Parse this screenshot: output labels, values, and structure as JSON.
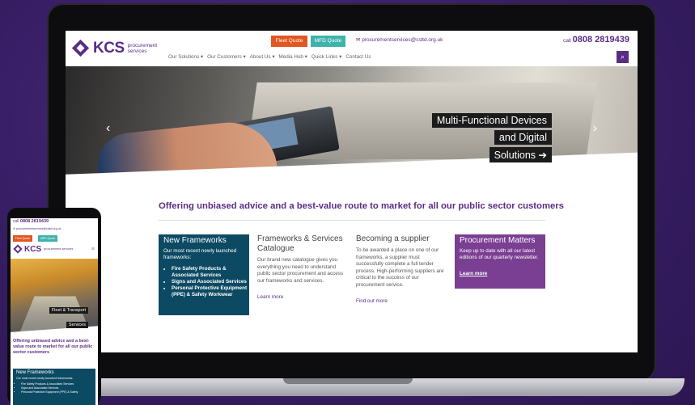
{
  "header": {
    "logo_text": "KCS",
    "logo_sub": "procurement services",
    "fleet_quote": "Fleet Quote",
    "mfd_quote": "MFD Quote",
    "email": "procurementservices@csltd.org.uk",
    "call_label": "call",
    "phone": "0808 2819439"
  },
  "nav": [
    "Our Solutions ▾",
    "Our Customers ▾",
    "About Us ▾",
    "Media Hub ▾",
    "Quick Links ▾",
    "Contact Us"
  ],
  "hero": {
    "caption": [
      "Multi-Functional Devices",
      "and Digital",
      "Solutions ➔"
    ],
    "prev": "‹",
    "next": "›"
  },
  "tagline": "Offering unbiased advice and a best-value route to market for all our public sector customers",
  "columns": {
    "new_frameworks": {
      "title": "New Frameworks",
      "intro": "Our most recent newly launched frameworks:",
      "items": [
        "Fire Safety Products & Associated Services",
        "Signs and Associated Services",
        "Personal Protective Equipment (PPE) & Safety Workwear"
      ]
    },
    "catalogue": {
      "title": "Frameworks & Services Catalogue",
      "body": "Our brand new catalogue gives you everything you need to understand public sector procurement and access our frameworks and services.",
      "link": "Learn more"
    },
    "supplier": {
      "title": "Becoming a supplier",
      "body": "To be awarded a place on one of our frameworks, a supplier must successfully complete a full tender process. High-performing suppliers are critical to the success of our procurement service.",
      "link": "Find out more"
    },
    "matters": {
      "title": "Procurement Matters",
      "body": "Keep up to date with all our latest editions of our quarterly newsletter.",
      "link": "Learn more"
    }
  },
  "mobile": {
    "call_label": "call",
    "phone": "0808 2819439",
    "email": "procurementservices@csltd.org.uk",
    "fleet_quote": "Fleet Quote",
    "mfd_quote": "MFD Quote",
    "logo_text": "KCS",
    "logo_sub": "procurement services",
    "menu_icon": "≡",
    "caption": [
      "Fleet & Transport",
      "Services"
    ],
    "tagline": "Offering unbiased advice and a best-value route to market for all our public sector customers",
    "new_title": "New Frameworks",
    "new_intro": "Our most recent newly launched frameworks:",
    "new_items": [
      "Fire Safety Products & Associated Services",
      "Signs and Associated Services",
      "Personal Protective Equipment (PPE) & Safety"
    ]
  },
  "colors": {
    "brand_purple": "#5b2c86",
    "fleet_orange": "#e2561f",
    "mfd_teal": "#3fb3ab",
    "teal_box": "#0c4a63",
    "purple_box": "#7a3e92"
  }
}
